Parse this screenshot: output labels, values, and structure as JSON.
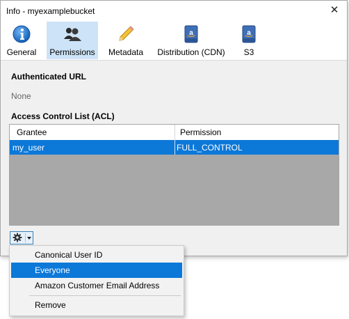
{
  "window": {
    "title": "Info - myexamplebucket"
  },
  "toolbar": {
    "items": [
      {
        "label": "General",
        "icon": "info-icon"
      },
      {
        "label": "Permissions",
        "icon": "users-icon",
        "active": true
      },
      {
        "label": "Metadata",
        "icon": "pencil-icon"
      },
      {
        "label": "Distribution (CDN)",
        "icon": "amazon-drive-icon"
      },
      {
        "label": "S3",
        "icon": "amazon-drive-icon"
      }
    ]
  },
  "auth_url": {
    "heading": "Authenticated URL",
    "value": "None"
  },
  "acl": {
    "heading": "Access Control List (ACL)",
    "columns": [
      "Grantee",
      "Permission"
    ],
    "rows": [
      {
        "grantee": "my_user",
        "permission": "FULL_CONTROL"
      }
    ]
  },
  "menu": {
    "items": [
      "Canonical User ID",
      "Everyone",
      "Amazon Customer Email Address",
      "Remove"
    ],
    "selected": "Everyone"
  },
  "colors": {
    "accent": "#0c78d8",
    "active_tab": "#cde3f7",
    "grid_empty": "#a8a8a8"
  }
}
